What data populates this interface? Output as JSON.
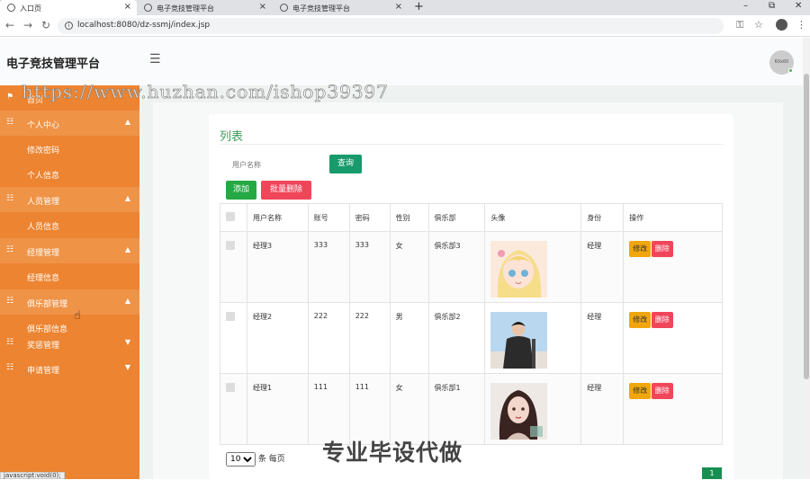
{
  "browser": {
    "tabs": [
      {
        "label": "入口页",
        "active": true
      },
      {
        "label": "电子竞技管理平台",
        "active": false
      },
      {
        "label": "电子竞技管理平台",
        "active": false
      }
    ],
    "new_tab": "+",
    "window_controls": {
      "minimize": "–",
      "restore": "⧉",
      "close": "✕"
    },
    "url": "localhost:8080/dz-ssmj/index.jsp"
  },
  "header": {
    "title": "电子竞技管理平台",
    "avatar_text": "60x60"
  },
  "watermark": "https://www.huzhan.com/ishop39397",
  "sidebar": {
    "items": [
      {
        "label": "首页",
        "icon": "flag-icon",
        "type": "top"
      },
      {
        "label": "个人中心",
        "icon": "grid-icon",
        "type": "group",
        "arrow": "▲"
      },
      {
        "label": "修改密码",
        "type": "sub"
      },
      {
        "label": "个人信息",
        "type": "sub"
      },
      {
        "label": "人员管理",
        "icon": "grid-icon",
        "type": "group",
        "arrow": "▲"
      },
      {
        "label": "人员信息",
        "type": "sub"
      },
      {
        "label": "经理管理",
        "icon": "grid-icon",
        "type": "group",
        "arrow": "▲"
      },
      {
        "label": "经理信息",
        "type": "sub"
      },
      {
        "label": "俱乐部管理",
        "icon": "grid-icon",
        "type": "group",
        "arrow": "▲"
      },
      {
        "label": "俱乐部信息",
        "type": "sub"
      },
      {
        "label": "奖惩管理",
        "icon": "grid-icon",
        "type": "top",
        "arrow": "▼"
      },
      {
        "label": "申请管理",
        "icon": "grid-icon",
        "type": "top",
        "arrow": "▼"
      }
    ]
  },
  "main": {
    "title": "列表",
    "search": {
      "placeholder": "用户名称",
      "query_label": "查询"
    },
    "add_label": "添加",
    "batch_delete_label": "批量删除",
    "table": {
      "headers": [
        "用户名称",
        "账号",
        "密码",
        "性别",
        "俱乐部",
        "头像",
        "身份",
        "操作"
      ],
      "rows": [
        {
          "name": "经理3",
          "account": "333",
          "password": "333",
          "gender": "女",
          "club": "俱乐部3",
          "avatar": "anime-girl-avatar",
          "role": "经理"
        },
        {
          "name": "经理2",
          "account": "222",
          "password": "222",
          "gender": "男",
          "club": "俱乐部2",
          "avatar": "young-man-avatar",
          "role": "经理"
        },
        {
          "name": "经理1",
          "account": "111",
          "password": "111",
          "gender": "女",
          "club": "俱乐部1",
          "avatar": "woman-illustration-avatar",
          "role": "经理"
        }
      ],
      "edit_label": "修改",
      "delete_label": "删除"
    },
    "page_size": "10",
    "page_size_suffix": "条 每页",
    "current_page": "1"
  },
  "overlay_text": "专业毕设代做",
  "status_tip": "javascript:void(0);",
  "colors": {
    "sidebar": "#ec8431",
    "sidebar_group": "#ef9347",
    "title_green": "#3c9a5a",
    "query": "#179a6c",
    "add": "#25a945",
    "delete": "#f0465a",
    "edit": "#f0a60c"
  }
}
